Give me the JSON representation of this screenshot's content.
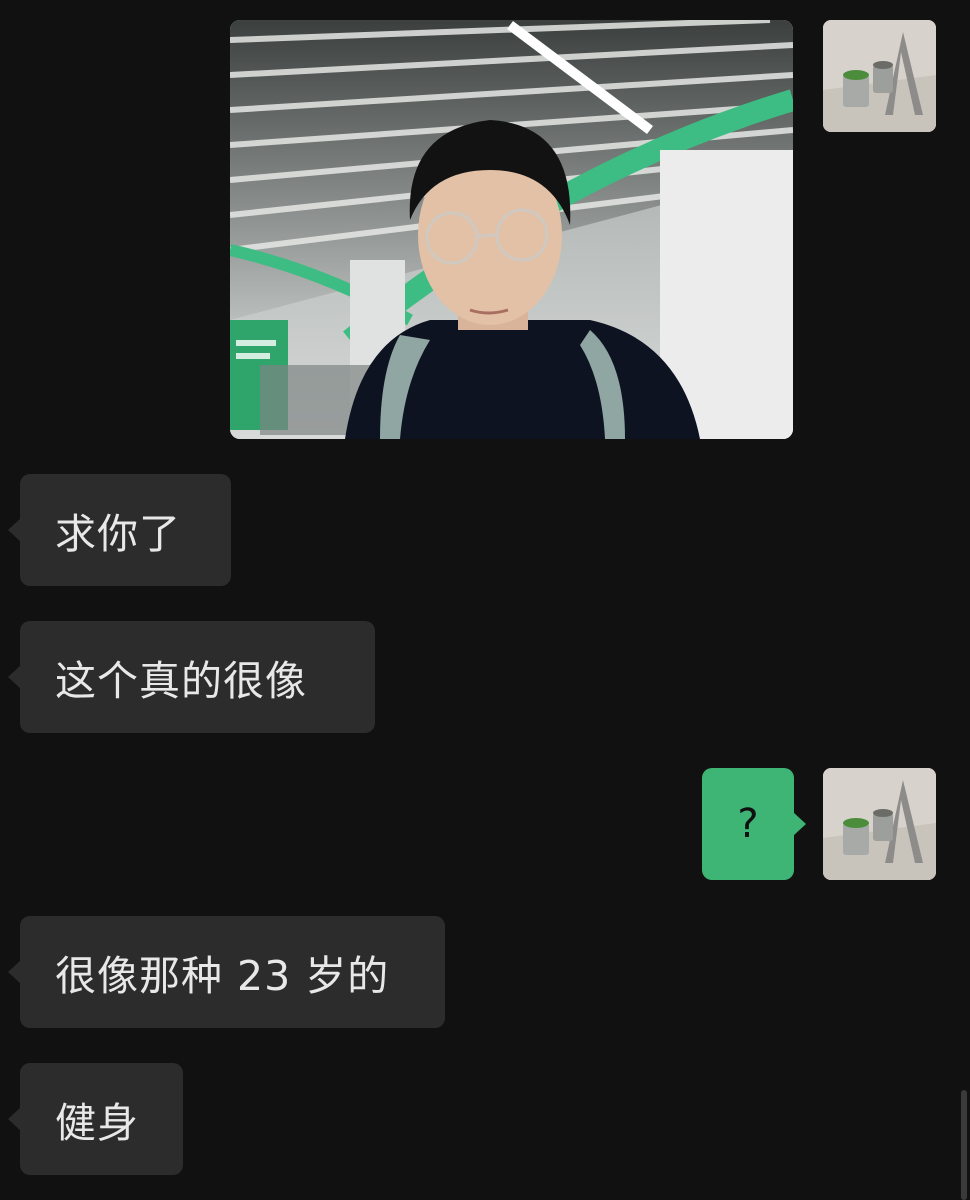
{
  "conversation": {
    "messages": [
      {
        "sender": "self",
        "kind": "image",
        "description_label": "photo"
      },
      {
        "sender": "other",
        "kind": "text",
        "text": "求你了"
      },
      {
        "sender": "other",
        "kind": "text",
        "text": "这个真的很像"
      },
      {
        "sender": "self",
        "kind": "text",
        "text": "?"
      },
      {
        "sender": "other",
        "kind": "text",
        "text": "很像那种 23 岁的"
      },
      {
        "sender": "other",
        "kind": "text",
        "text": "健身"
      }
    ]
  },
  "colors": {
    "background": "#111111",
    "incoming_bubble": "#2c2c2c",
    "outgoing_bubble": "#3eb575",
    "incoming_text": "#e8e8e8",
    "outgoing_text": "#101010"
  },
  "icons": {
    "self_avatar": "avatar-photo-paint-cans",
    "scrollbar": "scroll-thumb"
  }
}
